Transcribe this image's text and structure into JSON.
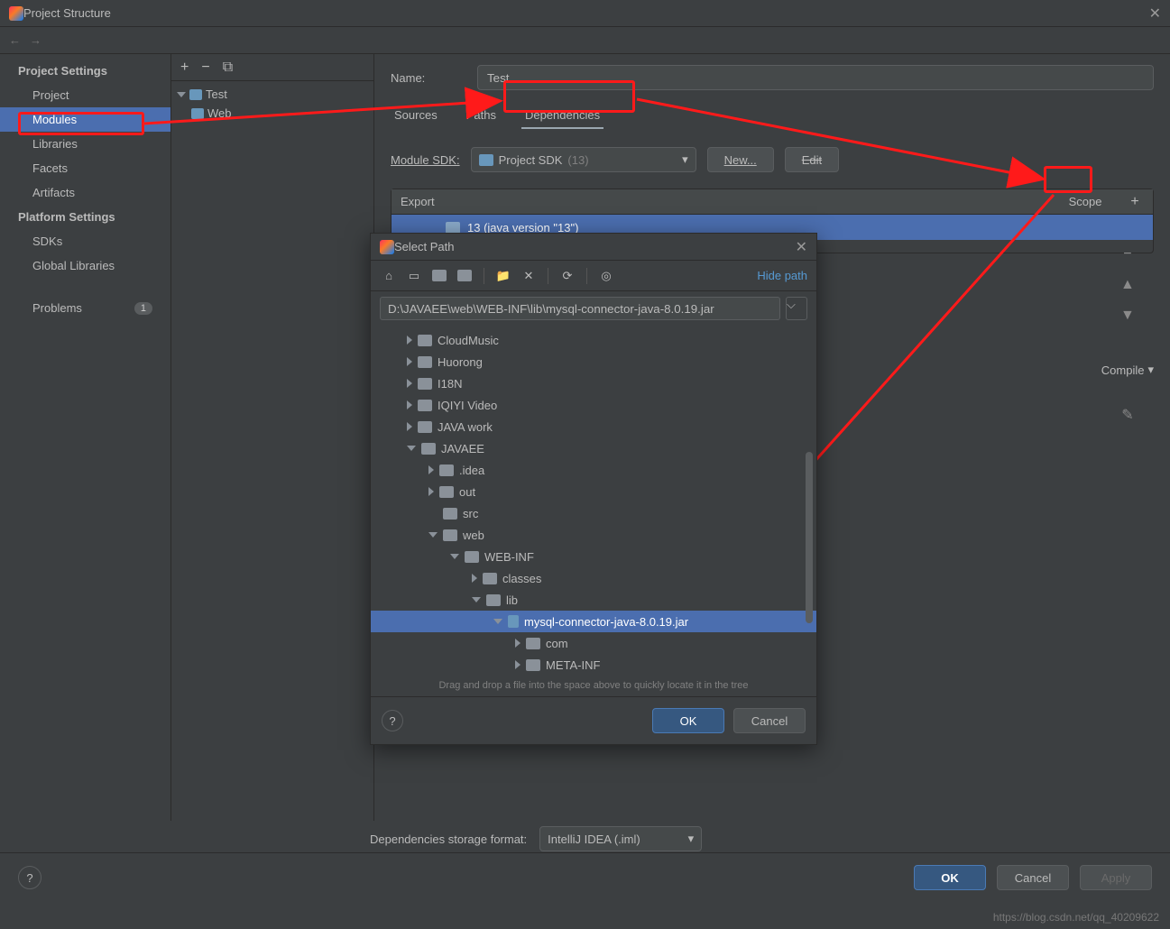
{
  "window": {
    "title": "Project Structure"
  },
  "sidebar": {
    "heading1": "Project Settings",
    "items1": [
      "Project",
      "Modules",
      "Libraries",
      "Facets",
      "Artifacts"
    ],
    "heading2": "Platform Settings",
    "items2": [
      "SDKs",
      "Global Libraries"
    ],
    "problems_label": "Problems",
    "problems_count": "1"
  },
  "modules": {
    "root": "Test",
    "child": "Web"
  },
  "content": {
    "name_label": "Name:",
    "name_value": "Test",
    "tabs": {
      "sources": "Sources",
      "paths": "Paths",
      "dependencies": "Dependencies"
    },
    "sdk_label": "Module SDK:",
    "sdk_value_prefix": "Project SDK ",
    "sdk_value_suffix": "(13)",
    "new_btn": "New...",
    "edit_btn": "Edit",
    "table_header_export": "Export",
    "table_header_scope": "Scope",
    "dep_row_1": "13 (java version \"13\")",
    "scope_label": "Compile",
    "storage_label": "Dependencies storage format:",
    "storage_value": "IntelliJ IDEA (.iml)"
  },
  "dialog": {
    "title": "Select Path",
    "hide_path": "Hide path",
    "path_value": "D:\\JAVAEE\\web\\WEB-INF\\lib\\mysql-connector-java-8.0.19.jar",
    "tree": {
      "CloudMusic": "CloudMusic",
      "Huorong": "Huorong",
      "I18N": "I18N",
      "IQIYI": "IQIYI Video",
      "JAVAwork": "JAVA work",
      "JAVAEE": "JAVAEE",
      "idea": ".idea",
      "out": "out",
      "src": "src",
      "web": "web",
      "WEBINF": "WEB-INF",
      "classes": "classes",
      "lib": "lib",
      "jar": "mysql-connector-java-8.0.19.jar",
      "com": "com",
      "METAINF": "META-INF"
    },
    "drag_hint": "Drag and drop a file into the space above to quickly locate it in the tree",
    "ok": "OK",
    "cancel": "Cancel"
  },
  "buttons": {
    "ok": "OK",
    "cancel": "Cancel",
    "apply": "Apply"
  },
  "watermark": "https://blog.csdn.net/qq_40209622"
}
